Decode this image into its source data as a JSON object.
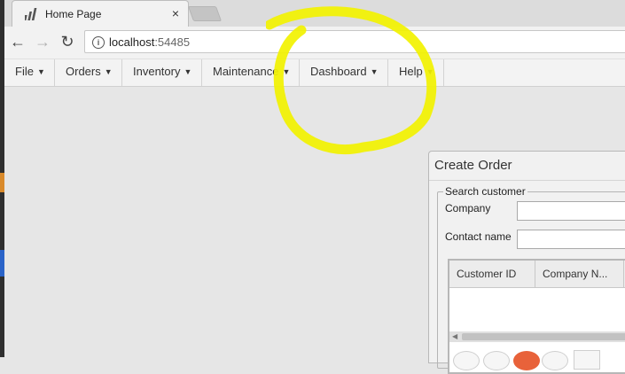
{
  "browser": {
    "tab_title": "Home Page",
    "tab_close": "×",
    "back_glyph": "←",
    "forward_glyph": "→",
    "reload_glyph": "↻",
    "info_glyph": "i",
    "url_host": "localhost",
    "url_port": ":54485"
  },
  "menu": {
    "arrow": "▼",
    "items": [
      {
        "label": "File"
      },
      {
        "label": "Orders"
      },
      {
        "label": "Inventory"
      },
      {
        "label": "Maintenance"
      },
      {
        "label": "Dashboard"
      },
      {
        "label": "Help"
      }
    ]
  },
  "dialog": {
    "title": "Create Order",
    "fieldset_legend": "Search customer",
    "company_label": "Company",
    "company_value": "",
    "contact_label": "Contact name",
    "contact_value": "",
    "grid": {
      "columns": [
        "Customer ID",
        "Company N..."
      ],
      "rows": []
    },
    "pager_active_page": ""
  },
  "annotation": {
    "color": "#f2f200",
    "shape": "circle-scribble"
  },
  "colors": {
    "pager_active": "#e8623a",
    "background": "#e6e6e6"
  }
}
